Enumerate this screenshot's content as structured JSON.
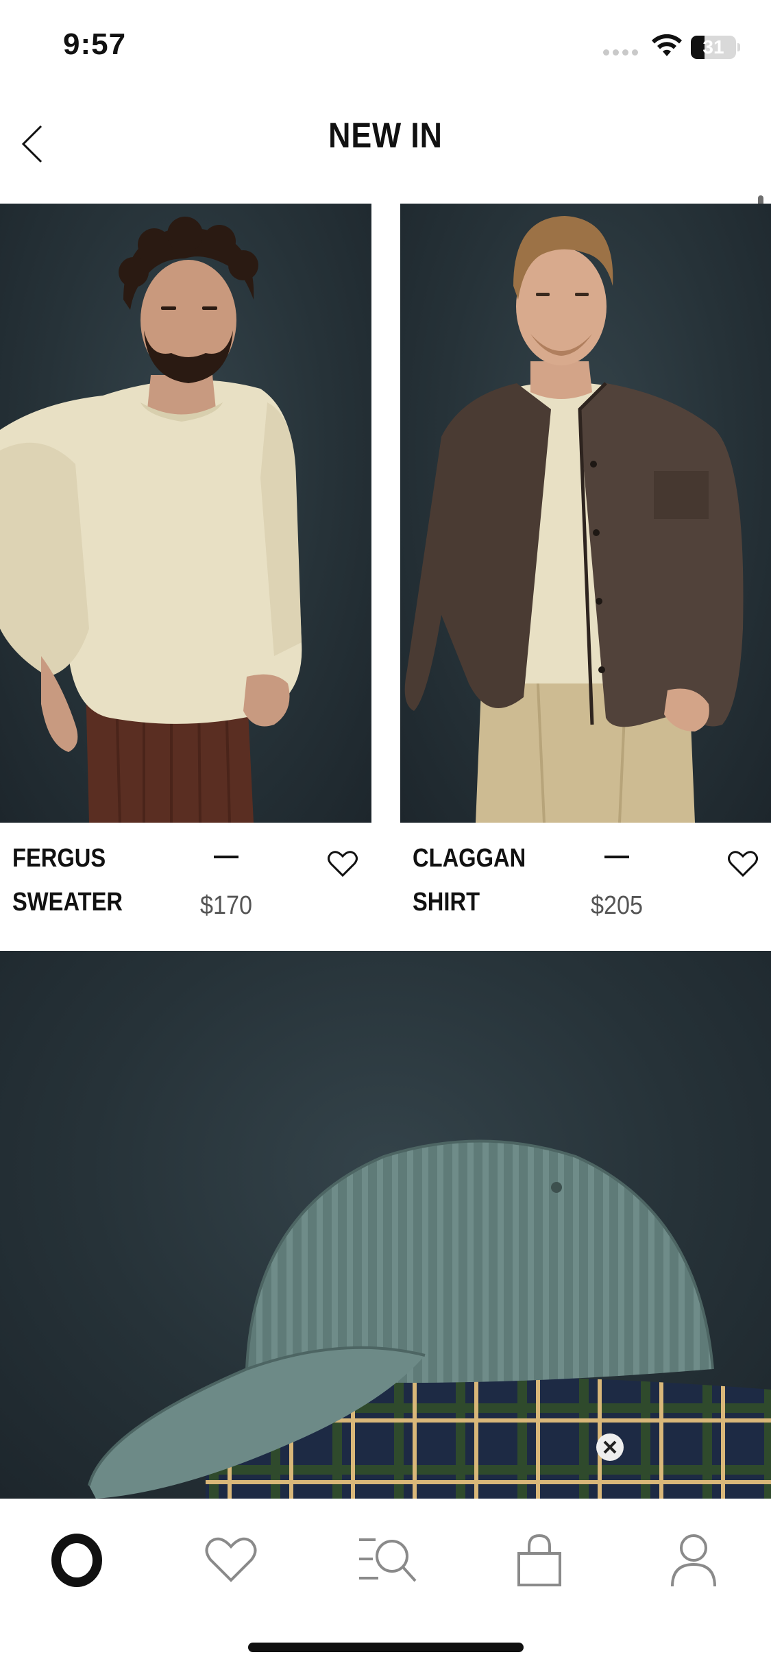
{
  "status_bar": {
    "time": "9:57",
    "battery_level": "31",
    "battery_fraction": 0.31,
    "icons": [
      "signal-dots-icon",
      "wifi-icon",
      "battery-icon"
    ]
  },
  "header": {
    "title": "NEW IN",
    "back_icon": "chevron-left-icon"
  },
  "products": [
    {
      "name": "FERGUS\nSWEATER",
      "price": "$170",
      "favorite_icon": "heart-outline-icon",
      "image": "man in cream sweater"
    },
    {
      "name": "CLAGGAN\nSHIRT",
      "price": "$205",
      "favorite_icon": "heart-outline-icon",
      "image": "man in brown shirt jacket"
    },
    {
      "image": "green corduroy cap on plaid shirt"
    }
  ],
  "tab_bar": {
    "items": [
      {
        "icon": "brand-logo-icon",
        "label": "O"
      },
      {
        "icon": "heart-icon"
      },
      {
        "icon": "search-menu-icon"
      },
      {
        "icon": "shopping-bag-icon"
      },
      {
        "icon": "profile-icon"
      }
    ]
  },
  "colors": {
    "background": "#ffffff",
    "text": "#111111",
    "price": "#555555",
    "image_backdrop": "#263238"
  }
}
